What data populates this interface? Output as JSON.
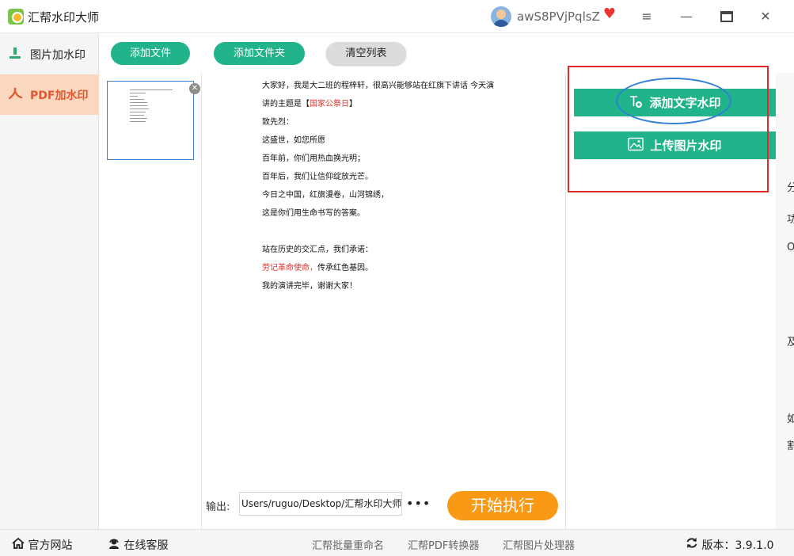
{
  "app": {
    "title": "汇帮水印大师",
    "username": "awS8PVjPqlsZ"
  },
  "window_controls": {
    "menu": "≡",
    "minimize": "—",
    "close": "✕"
  },
  "sidebar": {
    "items": [
      {
        "label": "图片加水印",
        "icon": "image-watermark-icon",
        "active": false
      },
      {
        "label": "PDF加水印",
        "icon": "pdf-icon",
        "active": true
      }
    ]
  },
  "toolbar": {
    "add_file": "添加文件",
    "add_folder": "添加文件夹",
    "clear_list": "清空列表"
  },
  "document": {
    "lines": [
      "大家好，我是大二班的程梓轩，很高兴能够站在红旗下讲话 今天演",
      "讲的主题是【",
      "致先烈：",
      "这盛世，如您所愿",
      "百年前，你们用热血换光明；",
      "百年后，我们让信仰绽放光芒。",
      "今日之中国，红旗漫卷，山河锦绣，",
      "这是你们用生命书写的答案。",
      "站在历史的交汇点，我们承诺：",
      "传承红色基因。",
      "我的演讲完毕，谢谢大家！"
    ],
    "red_topic": "国家公祭日",
    "topic_end": "】",
    "red_promise": "劳记革命使命，"
  },
  "output": {
    "label": "输出:",
    "path": "Users/ruguo/Desktop/汇帮水印大师",
    "more": "•••"
  },
  "run_button": "开始执行",
  "watermark": {
    "text_button": "添加文字水印",
    "image_button": "上传图片水印"
  },
  "right_strip": [
    "分",
    "功",
    "O",
    "及",
    "如",
    "割"
  ],
  "bottom": {
    "website": "官方网站",
    "support": "在线客服",
    "links": [
      "汇帮批量重命名",
      "汇帮PDF转换器",
      "汇帮图片处理器"
    ],
    "version": "版本：3.9.1.0"
  },
  "colors": {
    "accent_green": "#21b38a",
    "run_orange": "#f99916",
    "active_bg": "#fbd7c0",
    "active_text": "#e4572e"
  }
}
